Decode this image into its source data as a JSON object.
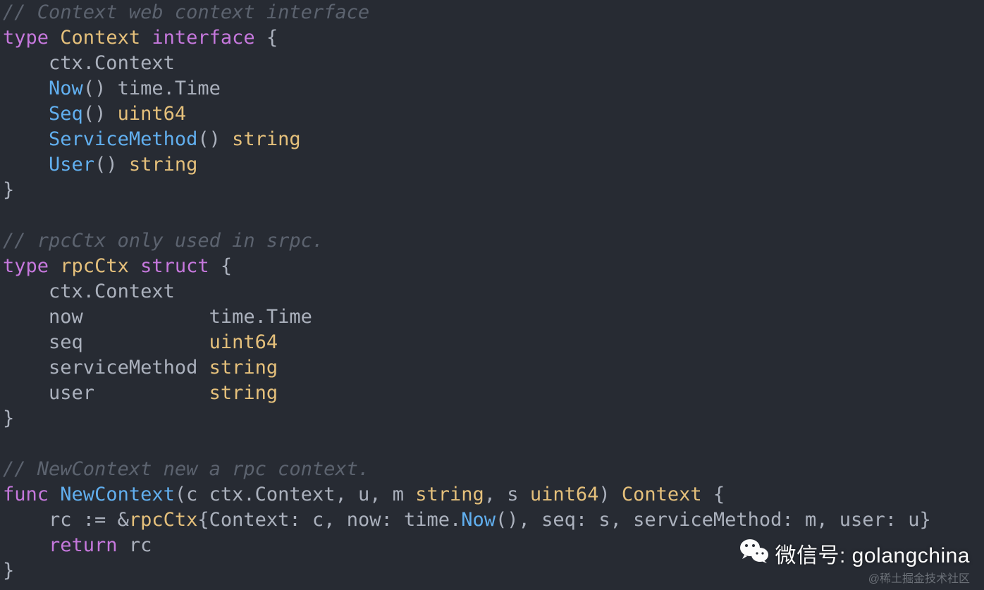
{
  "code": {
    "comment1": "// Context web context interface",
    "kw_type1": "type",
    "name_Context": "Context",
    "kw_interface": "interface",
    "brace_open": "{",
    "indent": "    ",
    "ctx_Context": "ctx.Context",
    "fn_Now": "Now",
    "parens": "()",
    "type_timeTime": "time.Time",
    "fn_Seq": "Seq",
    "type_uint64": "uint64",
    "fn_ServiceMethod": "ServiceMethod",
    "type_string": "string",
    "fn_User": "User",
    "brace_close": "}",
    "blank": "",
    "comment2": "// rpcCtx only used in srpc.",
    "kw_type2": "type",
    "name_rpcCtx": "rpcCtx",
    "kw_struct": "struct",
    "field_now": "now",
    "pad_now": "           ",
    "field_seq": "seq",
    "pad_seq": "           ",
    "field_serviceMethod": "serviceMethod",
    "pad_sm": " ",
    "field_user": "user",
    "pad_user": "          ",
    "comment3": "// NewContext new a rpc context.",
    "kw_func": "func",
    "fn_NewContext": "NewContext",
    "sig_open": "(c ",
    "sig_mid": ", u, m ",
    "sig_mid2": ", s ",
    "sig_close": ") ",
    "rc": "rc",
    "assign": " := ",
    "amp": "&",
    "struct_lit_open": "{Context: c, now: time.",
    "struct_lit_NowCall": "Now",
    "struct_lit_rest": "(), seq: s, serviceMethod: m, user: u}",
    "kw_return": "return"
  },
  "watermark": {
    "label": "微信号: golangchina",
    "sub": "@稀土掘金技术社区"
  }
}
